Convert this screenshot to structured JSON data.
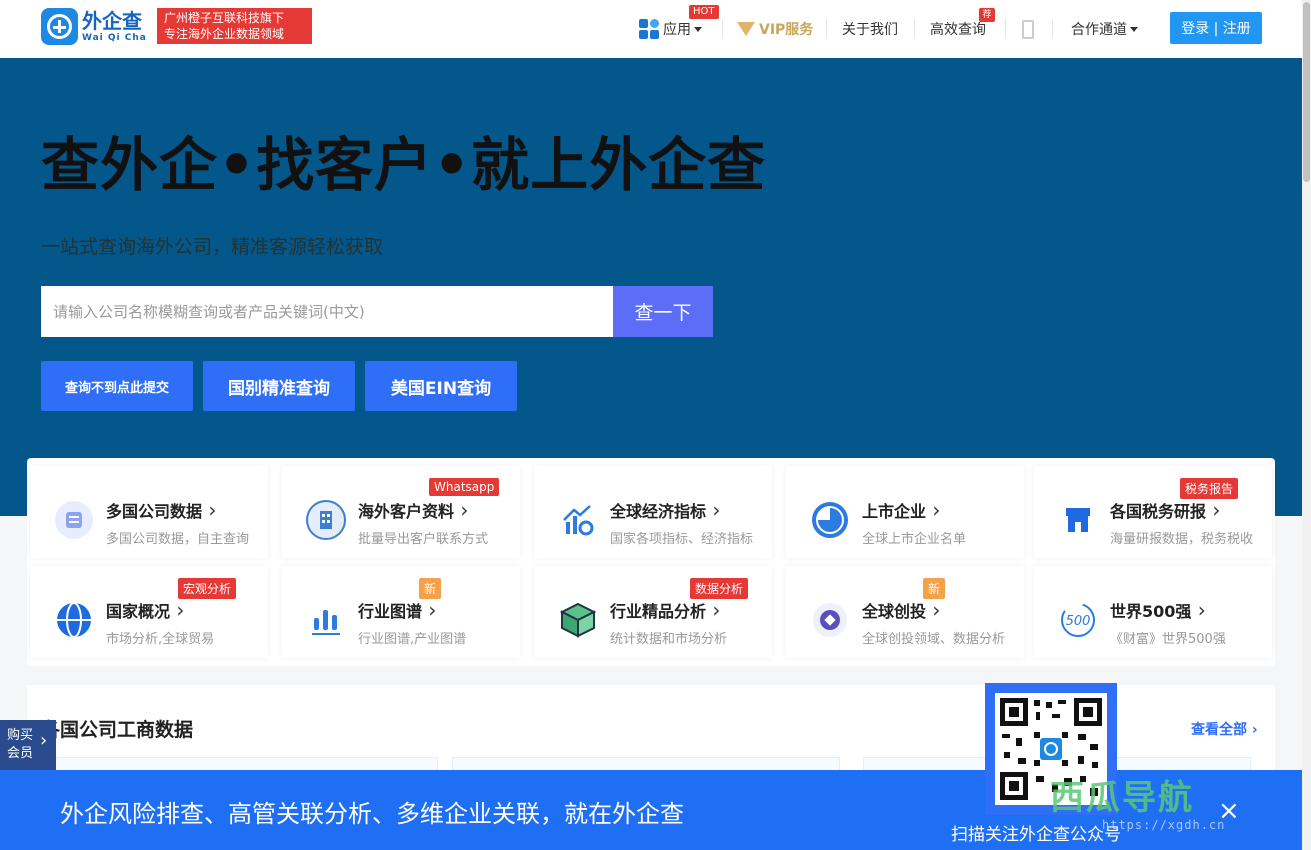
{
  "header": {
    "logo_cn": "外企查",
    "logo_en": "Wai Qi Cha",
    "slogan_line1": "广州橙子互联科技旗下",
    "slogan_line2": "专注海外企业数据领域",
    "nav_apps": "应用",
    "hot": "HOT",
    "nav_vip": "VIP服务",
    "nav_about": "关于我们",
    "nav_query": "高效查询",
    "tui": "荐",
    "nav_coop": "合作通道",
    "login": "登录 | 注册"
  },
  "hero": {
    "title": "查外企•找客户•就上外企查",
    "subtitle": "一站式查询海外公司，精准客源轻松获取",
    "search_placeholder": "请输入公司名称模糊查询或者产品关键词(中文)",
    "search_button": "查一下",
    "btn_submit": "查询不到点此提交",
    "btn_country": "国别精准查询",
    "btn_ein": "美国EIN查询"
  },
  "cards": [
    {
      "title": "多国公司数据",
      "desc": "多国公司数据，自主查询",
      "tag": ""
    },
    {
      "title": "海外客户资料",
      "desc": "批量导出客户联系方式",
      "tag": "Whatsapp"
    },
    {
      "title": "全球经济指标",
      "desc": "国家各项指标、经济指标",
      "tag": ""
    },
    {
      "title": "上市企业",
      "desc": "全球上市企业名单",
      "tag": ""
    },
    {
      "title": "各国税务研报",
      "desc": "海量研报数据，税务税收",
      "tag": "税务报告"
    },
    {
      "title": "国家概况",
      "desc": "市场分析,全球贸易",
      "tag": "宏观分析"
    },
    {
      "title": "行业图谱",
      "desc": "行业图谱,产业图谱",
      "tag": "新"
    },
    {
      "title": "行业精品分析",
      "desc": "统计数据和市场分析",
      "tag": "数据分析"
    },
    {
      "title": "全球创投",
      "desc": "全球创投领域、数据分析",
      "tag": "新"
    },
    {
      "title": "世界500强",
      "desc": "《财富》世界500强",
      "tag": ""
    }
  ],
  "section": {
    "title": "各国公司工商数据",
    "more": "查看全部"
  },
  "side": {
    "buy_line1": "购买",
    "buy_line2": "会员"
  },
  "banner": {
    "text": "外企风险排查、高管关联分析、多维企业关联，就在外企查",
    "close": "×",
    "qr_caption": "扫描关注外企查公众号"
  },
  "watermark": {
    "text": "西瓜导航",
    "url": "https://xgdh.cn"
  },
  "colors": {
    "brand": "#2196f3",
    "hero_bg": "#04578b",
    "accent_red": "#e53935",
    "banner": "#1f6ff5"
  }
}
